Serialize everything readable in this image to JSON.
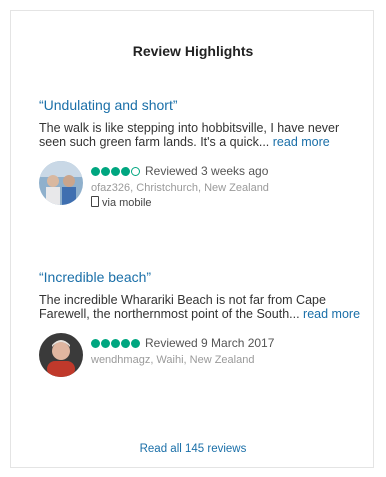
{
  "panel": {
    "heading": "Review Highlights",
    "read_all": "Read all 145 reviews"
  },
  "colors": {
    "link": "#1a6fa8",
    "bubble": "#00a680"
  },
  "reviews": [
    {
      "title": "“Undulating and short”",
      "body": "The walk is like stepping into hobbitsville, I have never seen such green farm lands. It's a quick...",
      "read_more": "read more",
      "rating": 4,
      "rating_max": 5,
      "date": "Reviewed 3 weeks ago",
      "user": "ofaz326, Christchurch, New Zealand",
      "via": "via mobile",
      "avatar_icon": "user-avatar"
    },
    {
      "title": "“Incredible beach”",
      "body": "The incredible Wharariki Beach is not far from Cape Farewell, the northernmost point of the South...",
      "read_more": "read more",
      "rating": 5,
      "rating_max": 5,
      "date": "Reviewed 9 March 2017",
      "user": "wendhmagz, Waihi, New Zealand",
      "via": "",
      "avatar_icon": "user-avatar"
    }
  ]
}
